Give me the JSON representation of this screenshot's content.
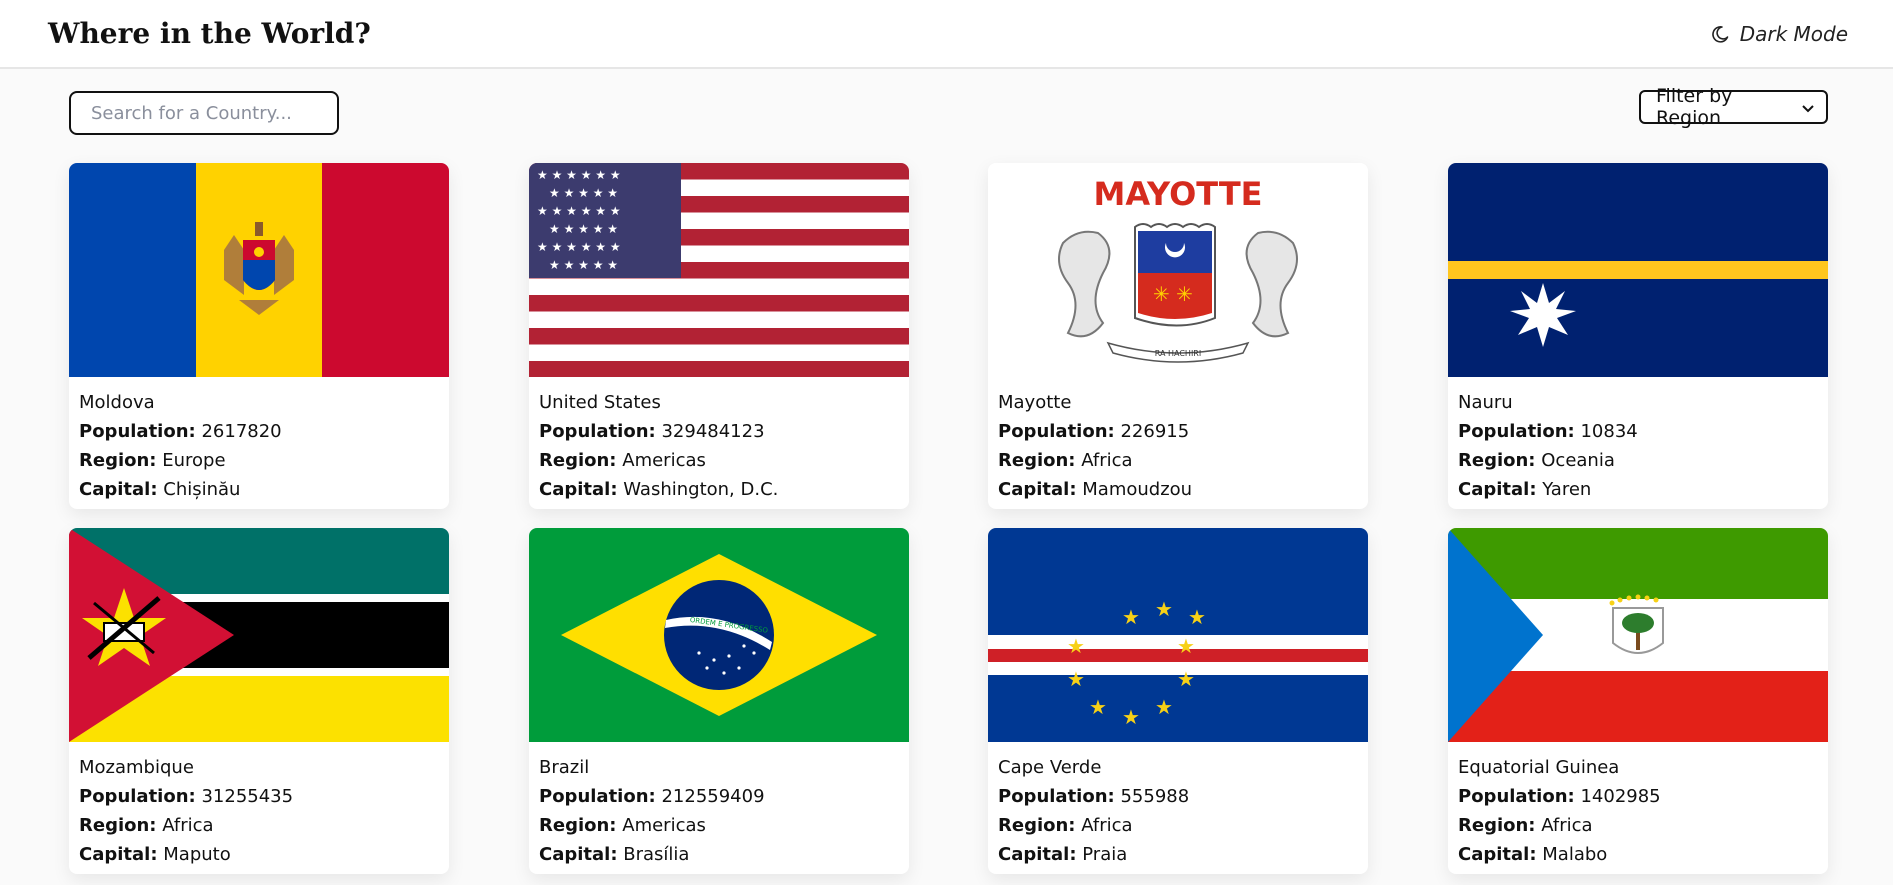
{
  "header": {
    "title": "Where in the World?",
    "mode_label": "Dark Mode",
    "mode_icon": "moon-icon"
  },
  "search": {
    "placeholder": "Search for a Country..."
  },
  "filter": {
    "selected": "Filter by Region"
  },
  "labels": {
    "population": "Population:",
    "region": "Region:",
    "capital": "Capital:"
  },
  "countries": [
    {
      "name": "Moldova",
      "population": "2617820",
      "region": "Europe",
      "capital": "Chișinău"
    },
    {
      "name": "United States",
      "population": "329484123",
      "region": "Americas",
      "capital": "Washington, D.C."
    },
    {
      "name": "Mayotte",
      "population": "226915",
      "region": "Africa",
      "capital": "Mamoudzou"
    },
    {
      "name": "Nauru",
      "population": "10834",
      "region": "Oceania",
      "capital": "Yaren"
    },
    {
      "name": "Mozambique",
      "population": "31255435",
      "region": "Africa",
      "capital": "Maputo"
    },
    {
      "name": "Brazil",
      "population": "212559409",
      "region": "Americas",
      "capital": "Brasília"
    },
    {
      "name": "Cape Verde",
      "population": "555988",
      "region": "Africa",
      "capital": "Praia"
    },
    {
      "name": "Equatorial Guinea",
      "population": "1402985",
      "region": "Africa",
      "capital": "Malabo"
    }
  ],
  "mayotte_flag_text": {
    "top": "MAYOTTE",
    "motto": "RA HACHIRI"
  },
  "brazil_motto": "ORDEM E PROGRESSO"
}
